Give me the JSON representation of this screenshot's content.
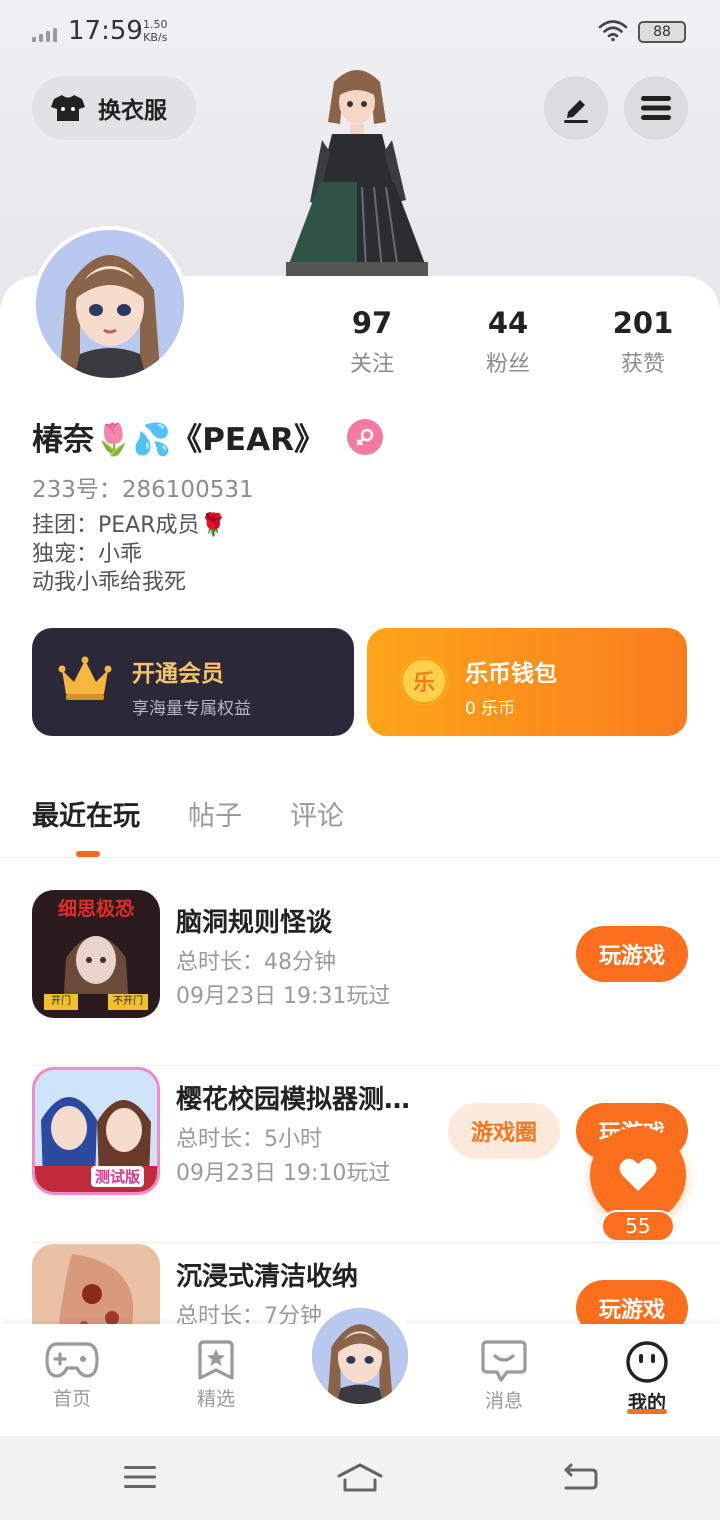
{
  "status_bar": {
    "time": "17:59",
    "speed_value": "1.50",
    "speed_unit": "KB/s",
    "battery": "88"
  },
  "header": {
    "outfit_label": "换衣服",
    "edit_icon": "pen-icon",
    "menu_icon": "menu-icon"
  },
  "profile": {
    "nickname": "椿奈🌷💦《PEAR》",
    "gender_icon": "female-icon",
    "uid": "233号：286100531",
    "bio": [
      "挂团：PEAR成员🌹",
      "独宠：小乖",
      "动我小乖给我死"
    ],
    "stats": [
      {
        "value": "97",
        "label": "关注"
      },
      {
        "value": "44",
        "label": "粉丝"
      },
      {
        "value": "201",
        "label": "获赞"
      }
    ]
  },
  "cards": {
    "vip": {
      "title": "开通会员",
      "subtitle": "享海量专属权益",
      "icon": "crown-icon"
    },
    "wallet": {
      "title": "乐币钱包",
      "subtitle": "0 乐币",
      "coin_glyph": "乐"
    }
  },
  "tabs": [
    {
      "label": "最近在玩",
      "active": true
    },
    {
      "label": "帖子",
      "active": false
    },
    {
      "label": "评论",
      "active": false
    }
  ],
  "games": [
    {
      "name": "脑洞规则怪谈",
      "duration": "总时长：48分钟",
      "last_played": "09月23日 19:31玩过",
      "play_label": "玩游戏",
      "icon_caption": "细思极恐",
      "icon_btn_left": "开门",
      "icon_btn_right": "不开门"
    },
    {
      "name": "樱花校园模拟器测…",
      "duration": "总时长：5小时",
      "last_played": "09月23日 19:10玩过",
      "play_label": "玩游戏",
      "circle_label": "游戏圈",
      "icon_badge": "测试版"
    },
    {
      "name": "沉浸式清洁收纳",
      "duration": "总时长：7分钟",
      "play_label": "玩游戏"
    }
  ],
  "like": {
    "count": "55"
  },
  "bottom_nav": [
    {
      "label": "首页",
      "icon": "gamepad-icon"
    },
    {
      "label": "精选",
      "icon": "star-bookmark-icon"
    },
    {
      "label": "消息",
      "icon": "chat-icon"
    },
    {
      "label": "我的",
      "icon": "face-icon",
      "active": true
    }
  ],
  "colors": {
    "accent": "#fb6f1d",
    "vip_bg": "#2b2838",
    "vip_text": "#f4c46a",
    "wallet_start": "#fda51a",
    "wallet_end": "#fa7d1e",
    "female": "#f57aa2"
  }
}
